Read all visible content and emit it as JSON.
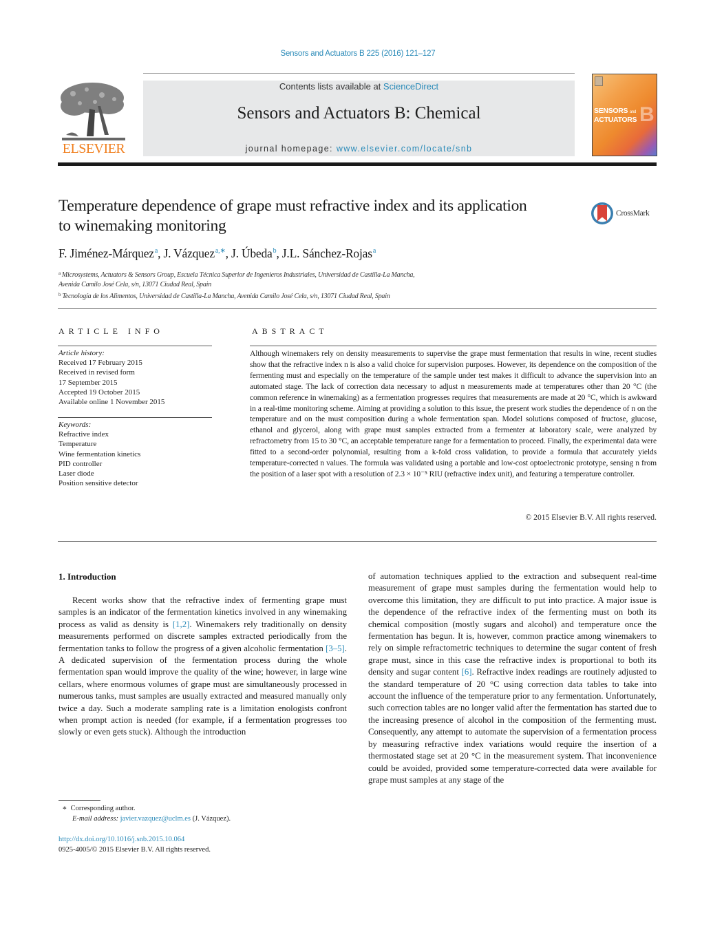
{
  "citation": "Sensors and Actuators B 225 (2016) 121–127",
  "header": {
    "publisher_logo": "ELSEVIER",
    "contents_prefix": "Contents lists available at ",
    "contents_link": "ScienceDirect",
    "journal_name": "Sensors and Actuators B: Chemical",
    "homepage_prefix": "journal homepage: ",
    "homepage_link": "www.elsevier.com/locate/snb",
    "cover": {
      "title_line1": "SENSORS",
      "title_and": "and",
      "title_line2": "ACTUATORS",
      "letter": "B"
    }
  },
  "article": {
    "title": "Temperature dependence of grape must refractive index and its application to winemaking monitoring",
    "crossmark_label": "CrossMark",
    "authors": [
      {
        "name": "F. Jiménez-Márquez",
        "aff": "a",
        "sep": ", "
      },
      {
        "name": "J. Vázquez",
        "aff": "a,∗",
        "sep": ", "
      },
      {
        "name": "J. Úbeda",
        "aff": "b",
        "sep": ", "
      },
      {
        "name": "J.L. Sánchez-Rojas",
        "aff": "a",
        "sep": ""
      }
    ],
    "affiliations": [
      {
        "mark": "a",
        "text": "Microsystems, Actuators & Sensors Group, Escuela Técnica Superior de Ingenieros Industriales, Universidad de Castilla-La Mancha,",
        "text2": "Avenida Camilo José Cela, s/n, 13071 Ciudad Real, Spain"
      },
      {
        "mark": "b",
        "text": "Tecnología de los Alimentos, Universidad de Castilla-La Mancha, Avenida Camilo José Cela, s/n, 13071 Ciudad Real, Spain"
      }
    ]
  },
  "article_info": {
    "heading": "ARTICLE INFO",
    "history_label": "Article history:",
    "history": [
      "Received 17 February 2015",
      "Received in revised form",
      "17 September 2015",
      "Accepted 19 October 2015",
      "Available online 1 November 2015"
    ],
    "keywords_label": "Keywords:",
    "keywords": [
      "Refractive index",
      "Temperature",
      "Wine fermentation kinetics",
      "PID controller",
      "Laser diode",
      "Position sensitive detector"
    ]
  },
  "abstract": {
    "heading": "ABSTRACT",
    "text": "Although winemakers rely on density measurements to supervise the grape must fermentation that results in wine, recent studies show that the refractive index n is also a valid choice for supervision purposes. However, its dependence on the composition of the fermenting must and especially on the temperature of the sample under test makes it difficult to advance the supervision into an automated stage. The lack of correction data necessary to adjust n measurements made at temperatures other than 20 °C (the common reference in winemaking) as a fermentation progresses requires that measurements are made at 20 °C, which is awkward in a real-time monitoring scheme. Aiming at providing a solution to this issue, the present work studies the dependence of n on the temperature and on the must composition during a whole fermentation span. Model solutions composed of fructose, glucose, ethanol and glycerol, along with grape must samples extracted from a fermenter at laboratory scale, were analyzed by refractometry from 15 to 30 °C, an acceptable temperature range for a fermentation to proceed. Finally, the experimental data were fitted to a second-order polynomial, resulting from a k-fold cross validation, to provide a formula that accurately yields temperature-corrected n values. The formula was validated using a portable and low-cost optoelectronic prototype, sensing n from the position of a laser spot with a resolution of 2.3 × 10⁻⁵ RIU (refractive index unit), and featuring a temperature controller.",
    "copyright": "© 2015 Elsevier B.V. All rights reserved."
  },
  "introduction": {
    "heading": "1.  Introduction",
    "left_parts": [
      {
        "t": "Recent works show that the refractive index of fermenting grape must samples is an indicator of the fermentation kinetics involved in any winemaking process as valid as density is ",
        "link": false
      },
      {
        "t": "[1,2]",
        "link": true
      },
      {
        "t": ". Winemakers rely traditionally on density measurements performed on discrete samples extracted periodically from the fermentation tanks to follow the progress of a given alcoholic fermentation ",
        "link": false
      },
      {
        "t": "[3–5]",
        "link": true
      },
      {
        "t": ". A dedicated supervision of the fermentation process during the whole fermentation span would improve the quality of the wine; however, in large wine cellars, where enormous volumes of grape must are simultaneously processed in numerous tanks, must samples are usually extracted and measured manually only twice a day. Such a moderate sampling rate is a limitation enologists confront when prompt action is needed (for example, if a fermentation progresses too slowly or even gets stuck). Although the introduction",
        "link": false
      }
    ],
    "right_parts": [
      {
        "t": "of automation techniques applied to the extraction and subsequent real-time measurement of grape must samples during the fermentation would help to overcome this limitation, they are difficult to put into practice. A major issue is the dependence of the refractive index of the fermenting must on both its chemical composition (mostly sugars and alcohol) and temperature once the fermentation has begun. It is, however, common practice among winemakers to rely on simple refractometric techniques to determine the sugar content of fresh grape must, since in this case the refractive index is proportional to both its density and sugar content ",
        "link": false
      },
      {
        "t": "[6]",
        "link": true
      },
      {
        "t": ". Refractive index readings are routinely adjusted to the standard temperature of 20 °C using correction data tables to take into account the influence of the temperature prior to any fermentation. Unfortunately, such correction tables are no longer valid after the fermentation has started due to the increasing presence of alcohol in the composition of the fermenting must. Consequently, any attempt to automate the supervision of a fermentation process by measuring refractive index variations would require the insertion of a thermostated stage set at 20 °C in the measurement system. That inconvenience could be avoided, provided some temperature-corrected data were available for grape must samples at any stage of the",
        "link": false
      }
    ]
  },
  "footnote": {
    "mark": "∗",
    "corresponding": "Corresponding author.",
    "email_label": "E-mail address:",
    "email": "javier.vazquez@uclm.es",
    "email_suffix": " (J. Vázquez)."
  },
  "doi": {
    "url": "http://dx.doi.org/10.1016/j.snb.2015.10.064",
    "issn_line": "0925-4005/© 2015 Elsevier B.V. All rights reserved."
  },
  "colors": {
    "link": "#2a8ab8",
    "elsevier_orange": "#f07f1e",
    "journal_box": "#e7e8e9"
  }
}
